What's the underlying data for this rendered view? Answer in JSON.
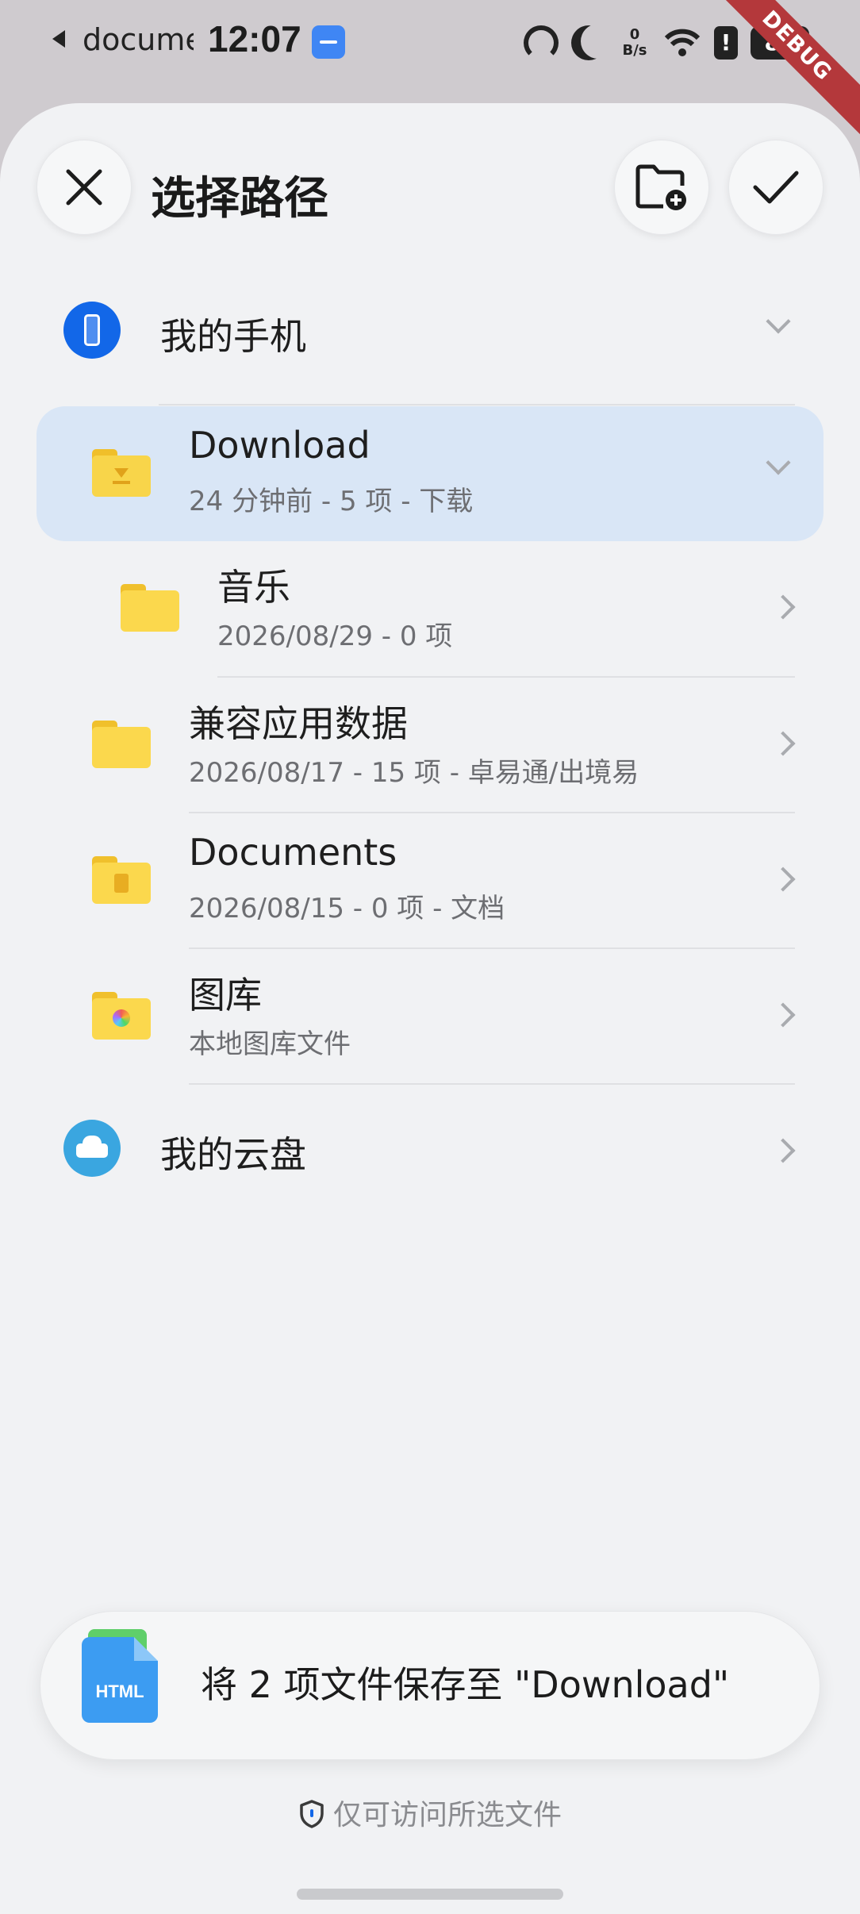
{
  "status_bar": {
    "back_app": "documer",
    "time": "12:07",
    "net_speed_value": "0",
    "net_speed_unit": "B/s",
    "alert": "!",
    "battery": "89",
    "debug_banner": "DEBUG"
  },
  "header": {
    "title": "选择路径",
    "icons": {
      "close": "close-icon",
      "new_folder": "folder-add-icon",
      "confirm": "check-icon"
    }
  },
  "locations": [
    {
      "label": "我的手机",
      "icon": "phone-icon",
      "icon_color": "#1267e8",
      "expanded": true
    }
  ],
  "folders": [
    {
      "name": "Download",
      "meta": "24 分钟前 - 5 项 - 下载",
      "icon": "download-folder-icon",
      "selected": true,
      "expanded": true
    },
    {
      "name": "音乐",
      "meta": "2026/08/29 - 0 项",
      "icon": "folder-icon",
      "indent": true
    },
    {
      "name": "兼容应用数据",
      "meta": "2026/08/17 - 15 项 - 卓易通/出境易",
      "icon": "folder-icon"
    },
    {
      "name": "Documents",
      "meta": "2026/08/15 - 0 项 - 文档",
      "icon": "documents-folder-icon"
    },
    {
      "name": "图库",
      "meta": "本地图库文件",
      "icon": "gallery-folder-icon"
    }
  ],
  "cloud": {
    "label": "我的云盘",
    "icon": "cloud-drive-icon",
    "icon_color": "#3aa6e0"
  },
  "save_card": {
    "file_type": "HTML",
    "text": "将 2 项文件保存至 \"Download\""
  },
  "footer": {
    "access_note": "仅可访问所选文件",
    "icon": "shield-icon"
  },
  "colors": {
    "accent": "#1267e8",
    "selected_bg": "#d9e6f6",
    "folder_yellow": "#f8d54a"
  }
}
